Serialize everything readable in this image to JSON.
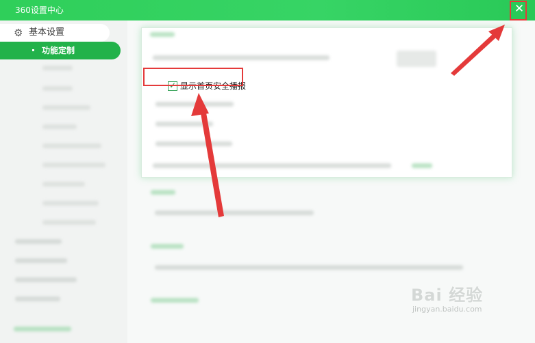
{
  "window": {
    "title": "360设置中心"
  },
  "colors": {
    "accent": "#22b24a",
    "annotation": "#e43a3a"
  },
  "sidebar": {
    "items": [
      {
        "label": "基本设置",
        "icon": "gear-icon"
      },
      {
        "label": "功能定制",
        "selected": true
      }
    ]
  },
  "content": {
    "checkbox": {
      "label": "显示首页安全播报",
      "checked": true
    }
  },
  "titlebar": {
    "close_label": "✕"
  },
  "watermark": {
    "brand": "Bai 经验",
    "url": "jingyan.baidu.com"
  }
}
